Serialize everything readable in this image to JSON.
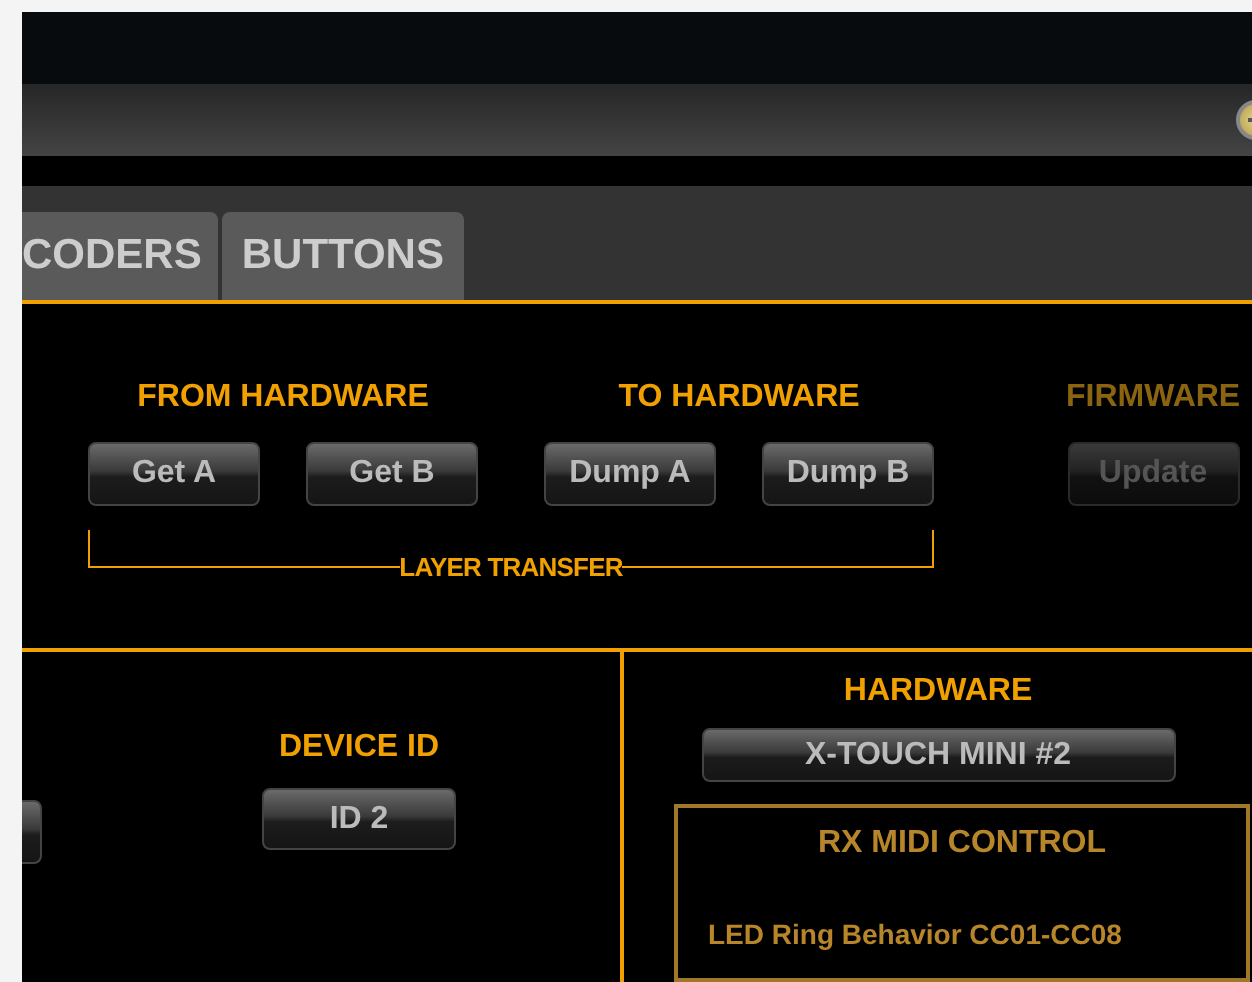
{
  "tabs": [
    {
      "label": "CODERS",
      "selected": false
    },
    {
      "label": "BUTTONS",
      "selected": false
    }
  ],
  "layer_transfer": {
    "groups": [
      {
        "title": "FROM HARDWARE",
        "buttons": [
          {
            "label": "Get A",
            "disabled": false
          },
          {
            "label": "Get B",
            "disabled": false
          }
        ]
      },
      {
        "title": "TO HARDWARE",
        "buttons": [
          {
            "label": "Dump A",
            "disabled": false
          },
          {
            "label": "Dump B",
            "disabled": false
          }
        ]
      }
    ],
    "label": "LAYER TRANSFER"
  },
  "firmware": {
    "title": "FIRMWARE",
    "button": {
      "label": "Update",
      "disabled": true
    }
  },
  "device_id": {
    "title": "DEVICE ID",
    "button": "ID 2"
  },
  "hardware": {
    "title": "HARDWARE",
    "button": "X-TOUCH MINI #2"
  },
  "rx_midi_control": {
    "title": "RX MIDI CONTROL",
    "items": [
      "LED Ring Behavior CC01-CC08"
    ]
  }
}
